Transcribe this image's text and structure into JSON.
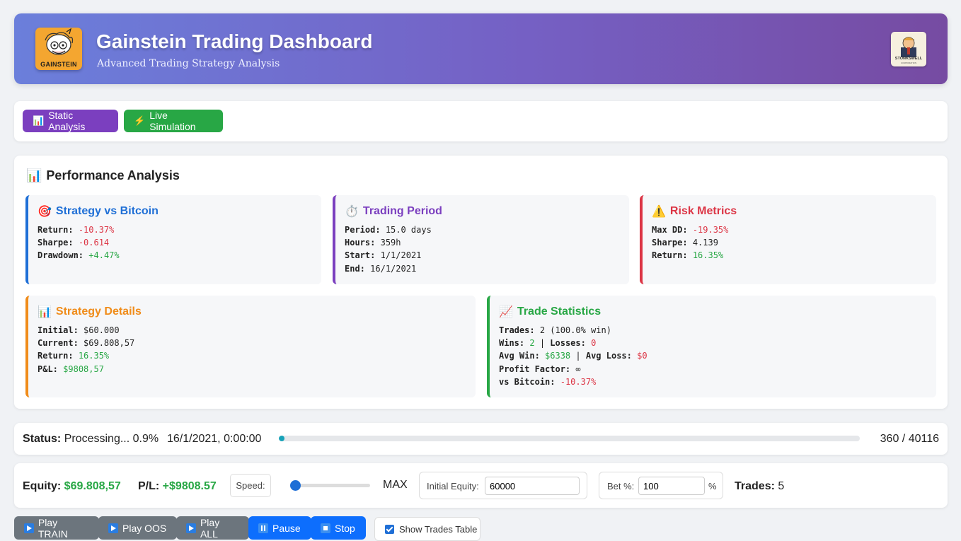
{
  "header": {
    "logo_text": "GAINSTEIN",
    "title": "Gainstein Trading Dashboard",
    "subtitle": "Advanced Trading Strategy Analysis",
    "partner_logo_text": "STONKSWELL",
    "partner_logo_sub": "CORPORATION"
  },
  "tabs": {
    "static_label": "Static Analysis",
    "static_icon": "bar-chart-icon",
    "live_label": "Live Simulation",
    "live_icon": "lightning-icon"
  },
  "performance": {
    "title": "Performance Analysis",
    "strategy_vs_bitcoin": {
      "title": "Strategy vs Bitcoin",
      "return_label": "Return:",
      "return_value": "-10.37%",
      "sharpe_label": "Sharpe:",
      "sharpe_value": "-0.614",
      "drawdown_label": "Drawdown:",
      "drawdown_value": "+4.47%"
    },
    "trading_period": {
      "title": "Trading Period",
      "period_label": "Period:",
      "period_value": "15.0 days",
      "hours_label": "Hours:",
      "hours_value": "359h",
      "start_label": "Start:",
      "start_value": "1/1/2021",
      "end_label": "End:",
      "end_value": "16/1/2021"
    },
    "risk_metrics": {
      "title": "Risk Metrics",
      "maxdd_label": "Max DD:",
      "maxdd_value": "-19.35%",
      "sharpe_label": "Sharpe:",
      "sharpe_value": "4.139",
      "return_label": "Return:",
      "return_value": "16.35%"
    },
    "strategy_details": {
      "title": "Strategy Details",
      "initial_label": "Initial:",
      "initial_value": "$60.000",
      "current_label": "Current:",
      "current_value": "$69.808,57",
      "return_label": "Return:",
      "return_value": "16.35%",
      "pl_label": "P&L:",
      "pl_value": "$9808,57"
    },
    "trade_statistics": {
      "title": "Trade Statistics",
      "trades_label": "Trades:",
      "trades_value": "2 (100.0% win)",
      "wins_label": "Wins:",
      "wins_value": "2",
      "sep": " | ",
      "losses_label": "Losses:",
      "losses_value": "0",
      "avgwin_label": "Avg Win:",
      "avgwin_value": "$6338",
      "avgloss_label": "Avg Loss:",
      "avgloss_value": "$0",
      "pf_label": "Profit Factor:",
      "pf_value": "∞",
      "vsbtc_label": "vs Bitcoin:",
      "vsbtc_value": "-10.37%"
    }
  },
  "status": {
    "label": "Status:",
    "text": "Processing... 0.9%",
    "timestamp": "16/1/2021, 0:00:00",
    "progress": 0.009,
    "count": "360 / 40116"
  },
  "controls": {
    "equity_label": "Equity:",
    "equity_value": "$69.808,57",
    "pl_label": "P/L:",
    "pl_value": "+$9808.57",
    "speed_label": "Speed:",
    "speed_slider_fraction": 0,
    "speed_value": "MAX",
    "initial_equity_label": "Initial Equity:",
    "initial_equity_value": "60000",
    "bet_label": "Bet %:",
    "bet_value": "100",
    "bet_unit": "%",
    "trades_label": "Trades:",
    "trades_value": "5"
  },
  "playback": {
    "play_train": "Play TRAIN",
    "play_oos": "Play OOS",
    "play_all": "Play ALL",
    "pause": "Pause",
    "stop": "Stop",
    "show_trades": "Show Trades Table",
    "show_trades_checked": true
  },
  "colors": {
    "accent_purple": "#7b3fbf",
    "accent_green": "#28a745",
    "accent_blue": "#0d6efd",
    "negative": "#dc3545"
  }
}
